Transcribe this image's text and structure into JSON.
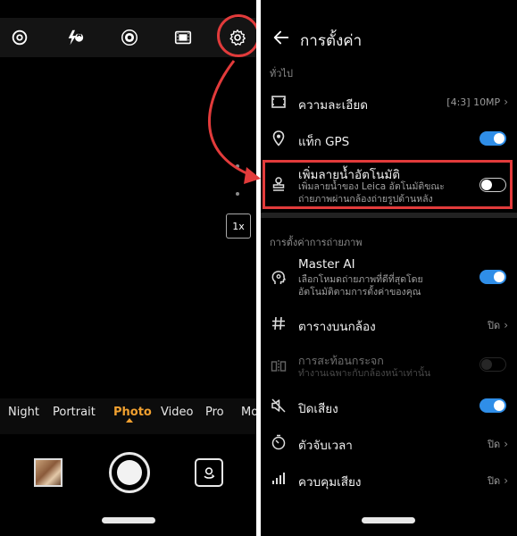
{
  "colors": {
    "accent": "#2f8ee8",
    "mode_active": "#f0a030",
    "highlight": "#e23b3b"
  },
  "camera": {
    "top_icons": [
      "ai-lens-icon",
      "flash-auto-icon",
      "aperture-icon",
      "film-icon",
      "gear-icon"
    ],
    "flash_badge": "A",
    "zoom_label": "1x",
    "modes": [
      "Night",
      "Portrait",
      "Photo",
      "Video",
      "Pro",
      "Mo"
    ],
    "active_mode": "Photo"
  },
  "settings": {
    "title": "การตั้งค่า",
    "section_general": "ทั่วไป",
    "resolution": {
      "label": "ความละเอียด",
      "value": "[4:3] 10MP"
    },
    "gps": {
      "label": "แท็ก GPS",
      "on": true
    },
    "watermark": {
      "label": "เพิ่มลายน้ำอัตโนมัติ",
      "sub_line1": "เพิ่มลายน้ำของ Leica อัตโนมัติขณะ",
      "sub_line2": "ถ่ายภาพผ่านกล้องถ่ายรูปด้านหลัง",
      "on": false
    },
    "section_capture": "การตั้งค่าการถ่ายภาพ",
    "master_ai": {
      "label": "Master AI",
      "sub_line1": "เลือกโหมดถ่ายภาพที่ดีที่สุดโดย",
      "sub_line2": "อัตโนมัติตามการตั้งค่าของคุณ",
      "on": true
    },
    "grid": {
      "label": "ตารางบนกล้อง",
      "value": "ปิด"
    },
    "mirror": {
      "label": "การสะท้อนกระจก",
      "sub": "ทำงานเฉพาะกับกล้องหน้าเท่านั้น",
      "on": false,
      "disabled": true
    },
    "mute": {
      "label": "ปิดเสียง",
      "on": true
    },
    "timer": {
      "label": "ตัวจับเวลา",
      "value": "ปิด"
    },
    "audio": {
      "label": "ควบคุมเสียง",
      "value": "ปิด"
    }
  }
}
